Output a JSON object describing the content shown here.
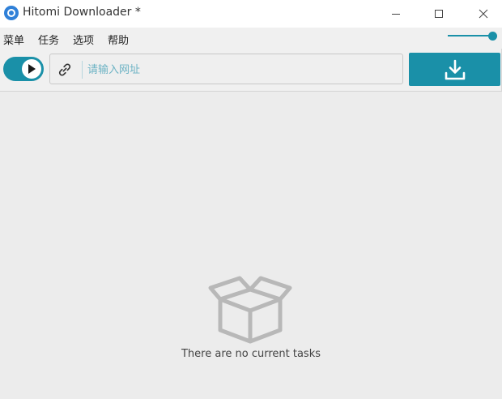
{
  "window": {
    "title": "Hitomi Downloader *"
  },
  "titlebar_buttons": {
    "minimize_icon": "minimize-icon",
    "maximize_icon": "maximize-icon",
    "close_icon": "close-icon"
  },
  "menu": {
    "items": [
      {
        "label": "菜单"
      },
      {
        "label": "任务"
      },
      {
        "label": "选项"
      },
      {
        "label": "帮助"
      }
    ]
  },
  "toolbar": {
    "toggle_icon": "play-icon",
    "url_placeholder": "请输入网址",
    "url_value": "",
    "link_icon": "link-icon",
    "download_icon": "download-icon",
    "slider_value_percent": 100
  },
  "colors": {
    "accent": "#1a90a8",
    "placeholder": "#6db3c4",
    "app_icon": "#2f80d8"
  },
  "empty_state": {
    "icon": "open-box-icon",
    "message": "There are no current tasks"
  }
}
